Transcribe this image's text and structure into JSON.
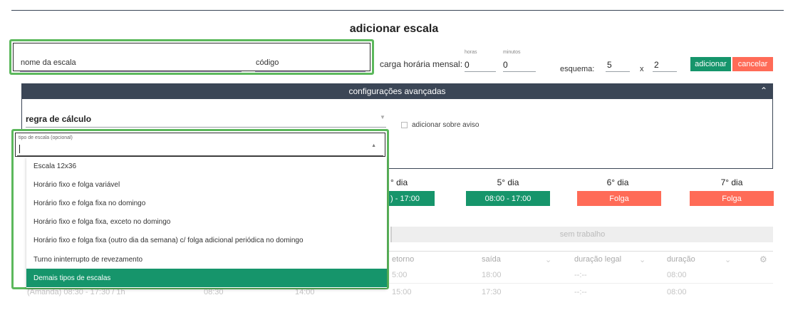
{
  "title": "adicionar escala",
  "form": {
    "nome_label": "nome da escala",
    "codigo_label": "código",
    "carga_label": "carga horária mensal:",
    "horas_label": "horas",
    "horas_value": "0",
    "minutos_label": "minutos",
    "minutos_value": "0",
    "esquema_label": "esquema:",
    "esquema_a": "5",
    "esquema_x": "x",
    "esquema_b": "2",
    "add_label": "adicionar",
    "cancel_label": "cancelar"
  },
  "advanced": {
    "header": "configurações avançadas",
    "regra_label": "regra de cálculo",
    "aviso_label": "adicionar sobre aviso"
  },
  "dropdown": {
    "label": "tipo de escala (opcional)",
    "options": [
      "Escala 12x36",
      "Horário fixo e folga variável",
      "Horário fixo e folga fixa no domingo",
      "Horário fixo e folga fixa, exceto no domingo",
      "Horário fixo e folga fixa (outro dia da semana) c/ folga adicional periódica no domingo",
      "Turno ininterrupto de revezamento",
      "Demais tipos de escalas"
    ],
    "selected_index": 6
  },
  "days": {
    "d4": "° dia",
    "d5": "5° dia",
    "d6": "6° dia",
    "d7": "7° dia",
    "s4": ") - 17:00",
    "s5": "08:00 - 17:00",
    "s6": "Folga",
    "s7": "Folga"
  },
  "sem_trabalho": "sem trabalho",
  "table": {
    "headers": [
      "etorno",
      "saída",
      "duração legal",
      "duração"
    ],
    "rows": [
      {
        "c1": "",
        "c2": "",
        "c3": "",
        "c4": "5:00",
        "c5": "18:00",
        "c6": "--:--",
        "c7": "08:00"
      },
      {
        "c1": "(Amanda) 08:30 - 17:30 / 1h",
        "c2": "08:30",
        "c3": "14:00",
        "c4": "15:00",
        "c5": "17:30",
        "c6": "--:--",
        "c7": "08:00"
      }
    ]
  },
  "colors": {
    "accent_green": "#16956b",
    "accent_red": "#ff6b57",
    "header_dark": "#3b4656",
    "highlight": "#5cb85c"
  }
}
